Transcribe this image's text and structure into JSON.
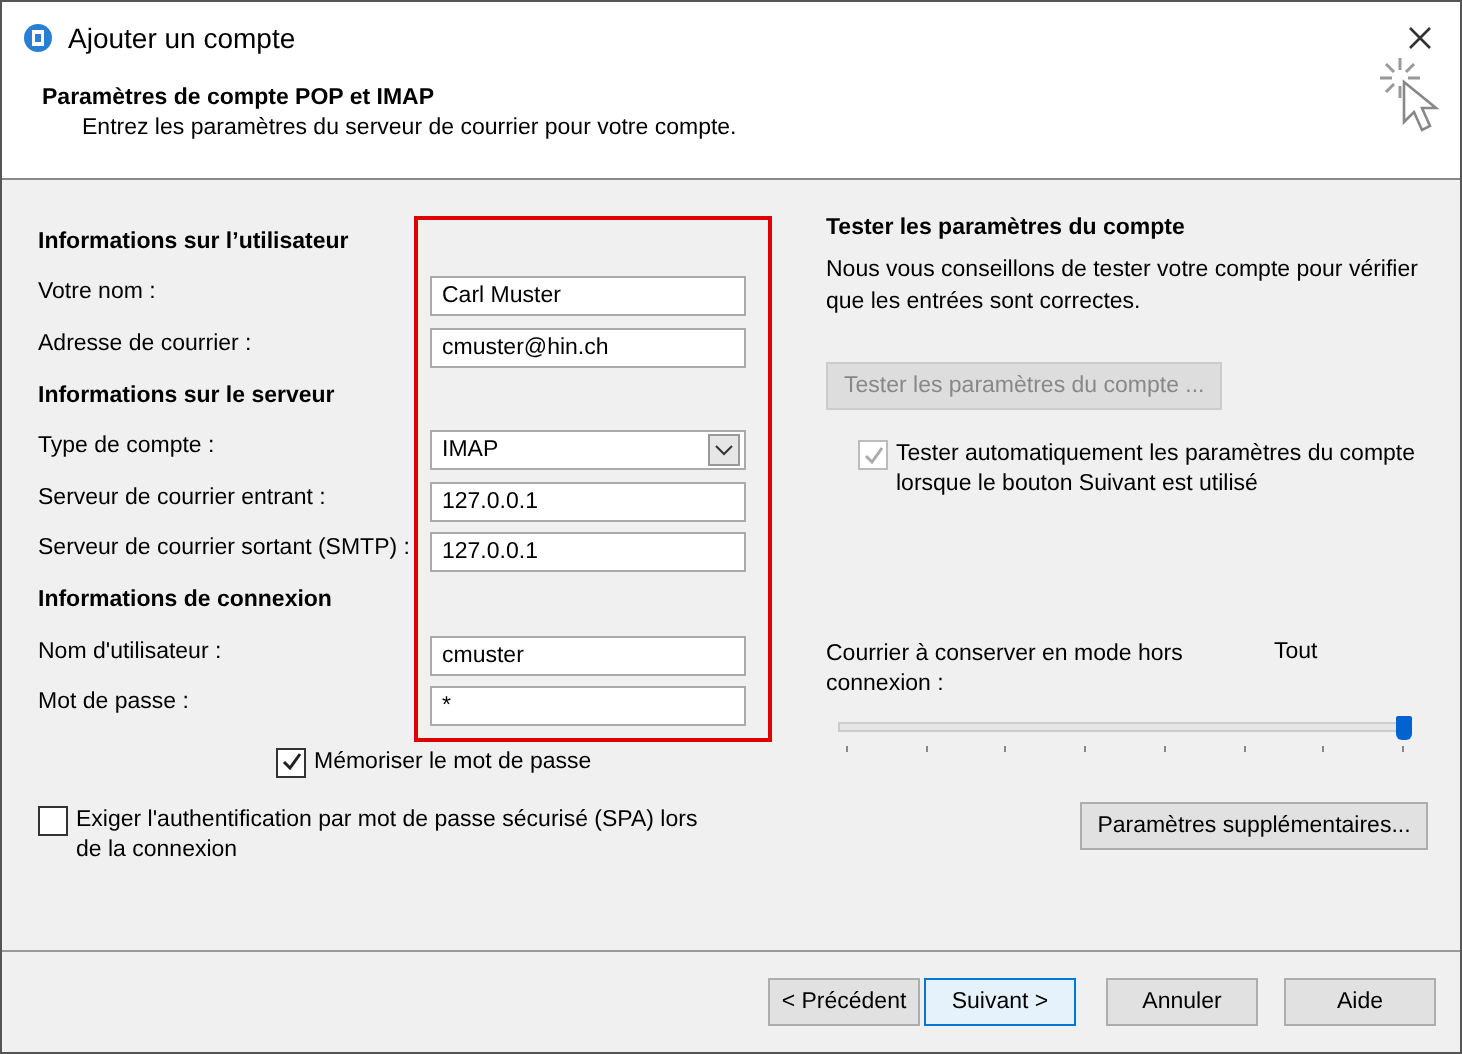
{
  "window": {
    "title": "Ajouter un compte"
  },
  "header": {
    "title": "Paramètres de compte POP et IMAP",
    "subtitle": "Entrez les paramètres du serveur de courrier pour votre compte."
  },
  "form": [
    {
      "kind": "heading",
      "label": "Informations sur l’utilisateur"
    },
    {
      "kind": "text",
      "label": "Votre nom :",
      "value": "Carl Muster"
    },
    {
      "kind": "text",
      "label": "Adresse de courrier :",
      "value": "cmuster@hin.ch"
    },
    {
      "kind": "heading",
      "label": "Informations sur le serveur"
    },
    {
      "kind": "select",
      "label": "Type de compte :",
      "value": "IMAP"
    },
    {
      "kind": "text",
      "label": "Serveur de courrier entrant :",
      "value": "127.0.0.1"
    },
    {
      "kind": "text",
      "label": "Serveur de courrier sortant (SMTP) :",
      "value": "127.0.0.1"
    },
    {
      "kind": "heading",
      "label": "Informations de connexion"
    },
    {
      "kind": "text",
      "label": "Nom d'utilisateur :",
      "value": "cmuster"
    },
    {
      "kind": "text",
      "label": "Mot de passe :",
      "value": "*"
    }
  ],
  "remember_password": {
    "label": "Mémoriser le mot de passe",
    "checked": true
  },
  "spa": {
    "label": "Exiger l'authentification par mot de passe sécurisé (SPA) lors de la connexion",
    "checked": false
  },
  "test": {
    "title": "Tester les paramètres du compte",
    "text": "Nous vous conseillons de tester votre compte pour vérifier que les entrées sont correctes.",
    "button": {
      "label": "Tester les paramètres du compte ...",
      "disabled": true
    },
    "auto": {
      "label": "Tester automatiquement les paramètres du compte lorsque le bouton Suivant est utilisé",
      "checked": true,
      "disabled": true
    }
  },
  "offline": {
    "label": "Courrier à conserver en mode hors connexion :",
    "value": "Tout",
    "level": 1
  },
  "more_button": "Paramètres supplémentaires...",
  "buttons": [
    {
      "label": "< Précédent",
      "focused": false
    },
    {
      "label": "Suivant >",
      "focused": true
    },
    {
      "label": "Annuler",
      "focused": false
    },
    {
      "label": "Aide",
      "focused": false
    }
  ]
}
